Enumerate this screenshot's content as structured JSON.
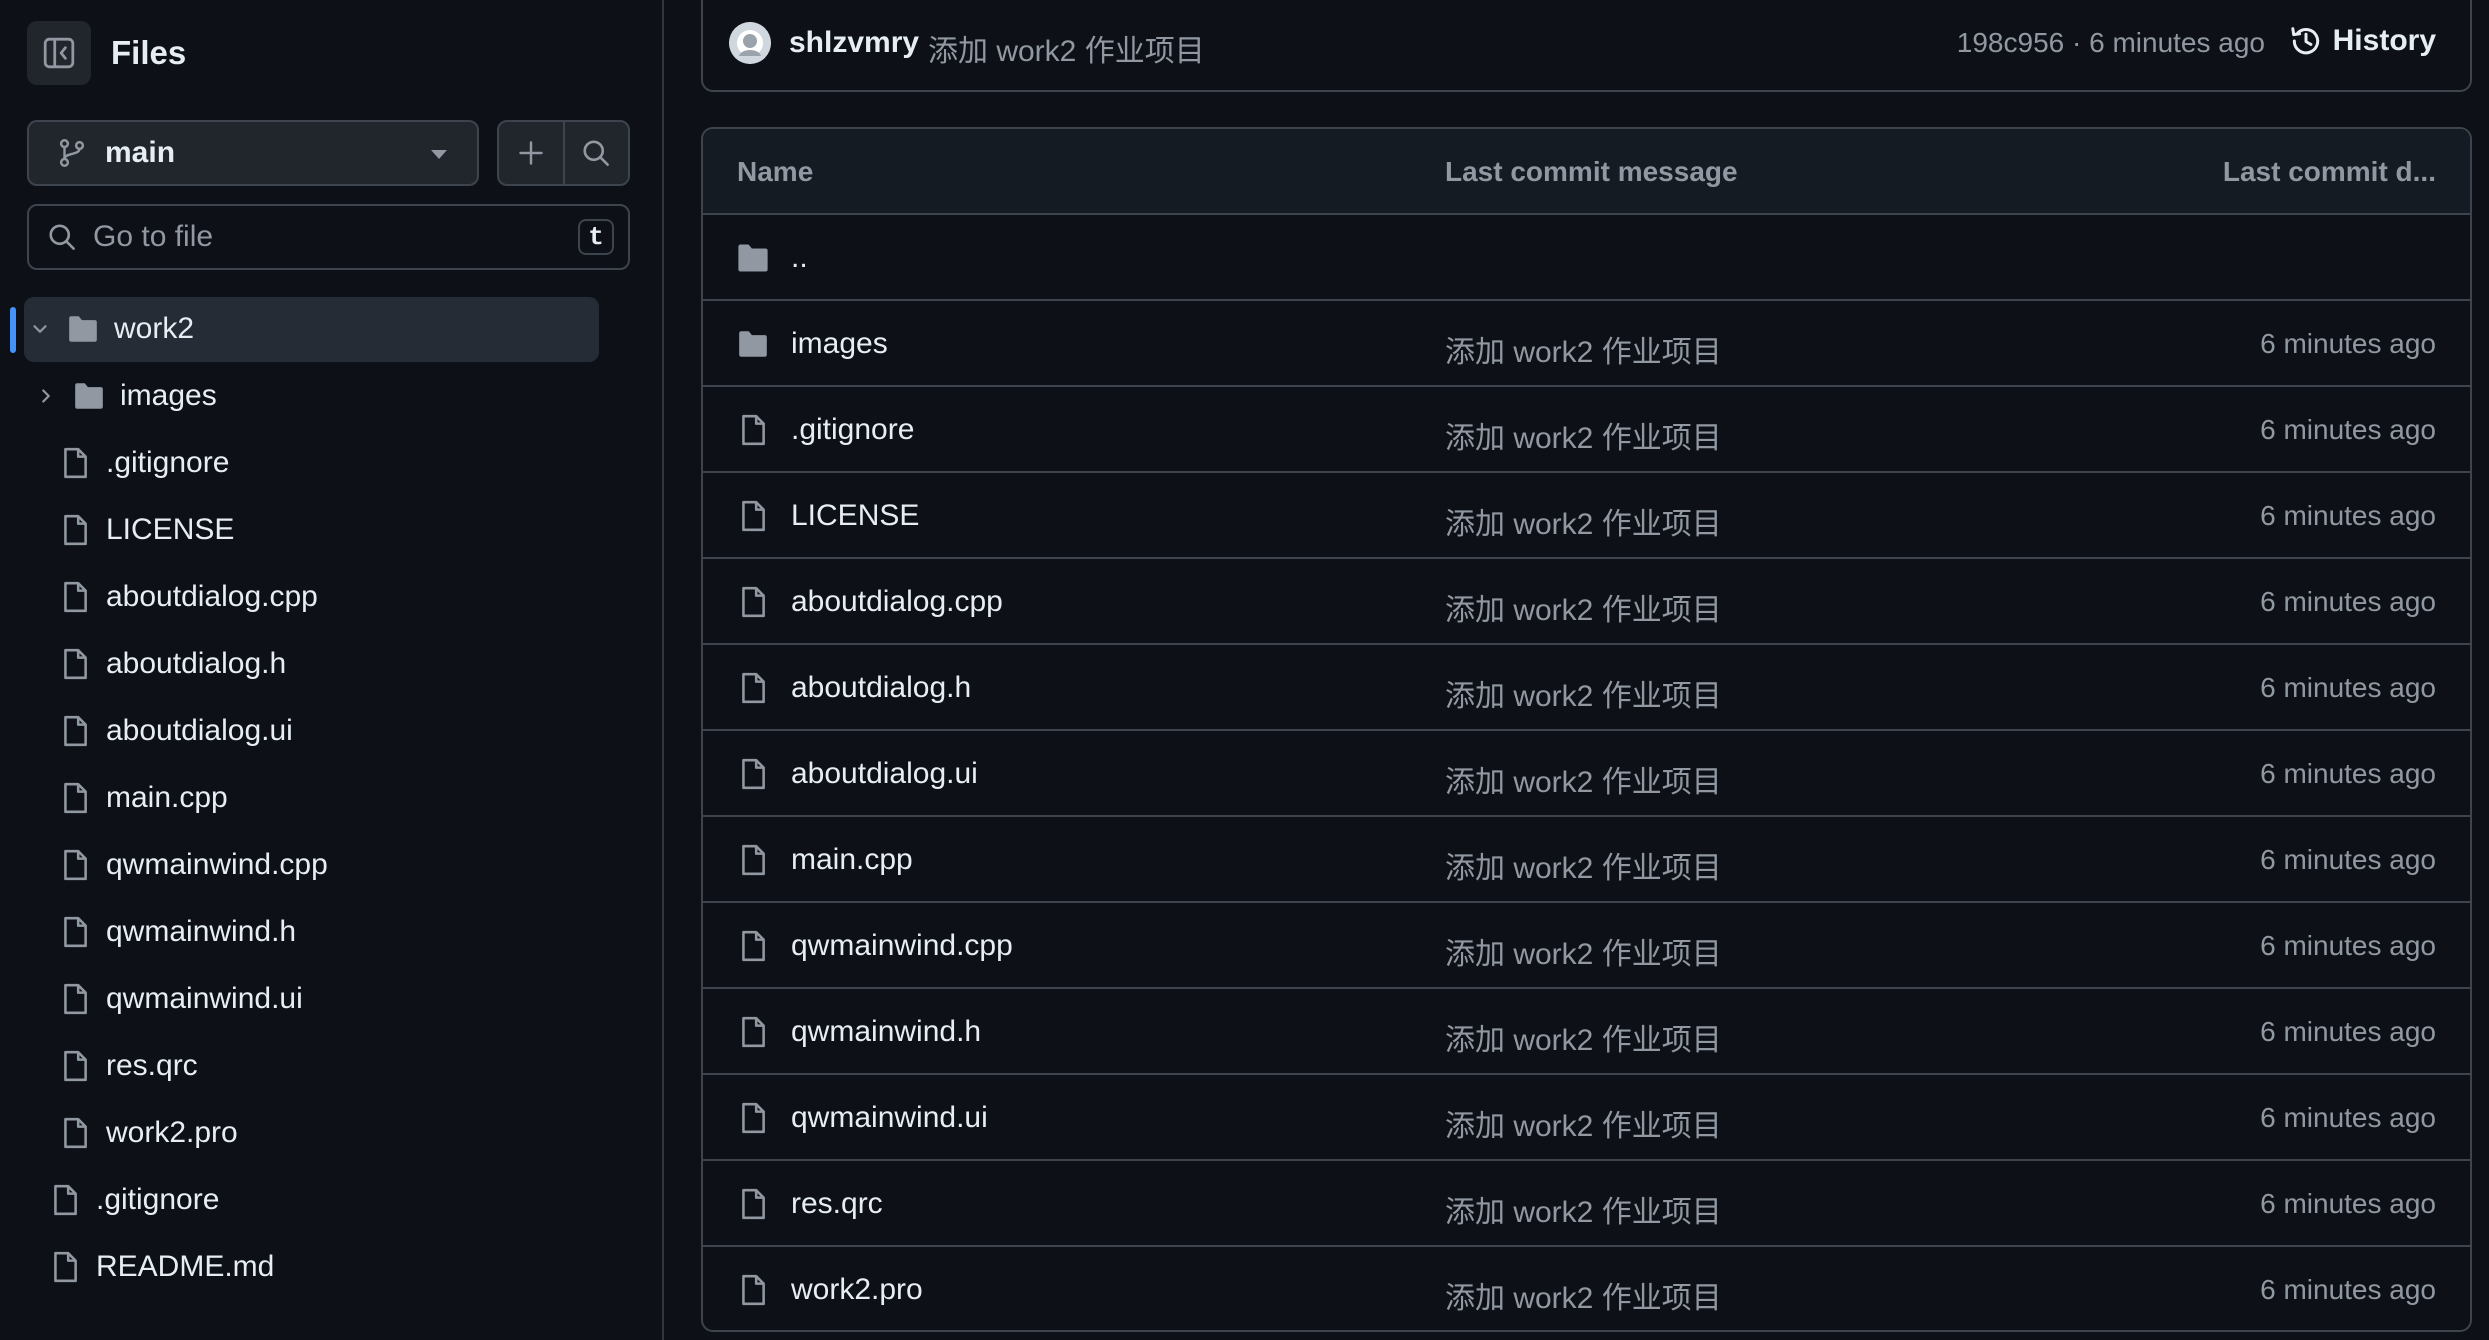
{
  "sidebar": {
    "title": "Files",
    "branch": "main",
    "goto_placeholder": "Go to file",
    "goto_shortcut": "t",
    "tree": [
      {
        "label": "work2",
        "type": "folder",
        "expanded": true,
        "selected": true,
        "depth": 0
      },
      {
        "label": "images",
        "type": "folder",
        "expanded": false,
        "depth": 1
      },
      {
        "label": ".gitignore",
        "type": "file",
        "depth": 1
      },
      {
        "label": "LICENSE",
        "type": "file",
        "depth": 1
      },
      {
        "label": "aboutdialog.cpp",
        "type": "file",
        "depth": 1
      },
      {
        "label": "aboutdialog.h",
        "type": "file",
        "depth": 1
      },
      {
        "label": "aboutdialog.ui",
        "type": "file",
        "depth": 1
      },
      {
        "label": "main.cpp",
        "type": "file",
        "depth": 1
      },
      {
        "label": "qwmainwind.cpp",
        "type": "file",
        "depth": 1
      },
      {
        "label": "qwmainwind.h",
        "type": "file",
        "depth": 1
      },
      {
        "label": "qwmainwind.ui",
        "type": "file",
        "depth": 1
      },
      {
        "label": "res.qrc",
        "type": "file",
        "depth": 1
      },
      {
        "label": "work2.pro",
        "type": "file",
        "depth": 1
      },
      {
        "label": ".gitignore",
        "type": "file",
        "depth": 0
      },
      {
        "label": "README.md",
        "type": "file",
        "depth": 0
      }
    ]
  },
  "commit": {
    "author": "shlzvmry",
    "message": "添加 work2 作业项目",
    "meta": "198c956 · 6 minutes ago",
    "history_label": "History"
  },
  "table": {
    "headers": {
      "name": "Name",
      "message": "Last commit message",
      "date": "Last commit d..."
    },
    "parent_row": "..",
    "rows": [
      {
        "name": "images",
        "type": "folder",
        "message": "添加 work2 作业项目",
        "date": "6 minutes ago"
      },
      {
        "name": ".gitignore",
        "type": "file",
        "message": "添加 work2 作业项目",
        "date": "6 minutes ago"
      },
      {
        "name": "LICENSE",
        "type": "file",
        "message": "添加 work2 作业项目",
        "date": "6 minutes ago"
      },
      {
        "name": "aboutdialog.cpp",
        "type": "file",
        "message": "添加 work2 作业项目",
        "date": "6 minutes ago"
      },
      {
        "name": "aboutdialog.h",
        "type": "file",
        "message": "添加 work2 作业项目",
        "date": "6 minutes ago"
      },
      {
        "name": "aboutdialog.ui",
        "type": "file",
        "message": "添加 work2 作业项目",
        "date": "6 minutes ago"
      },
      {
        "name": "main.cpp",
        "type": "file",
        "message": "添加 work2 作业项目",
        "date": "6 minutes ago"
      },
      {
        "name": "qwmainwind.cpp",
        "type": "file",
        "message": "添加 work2 作业项目",
        "date": "6 minutes ago"
      },
      {
        "name": "qwmainwind.h",
        "type": "file",
        "message": "添加 work2 作业项目",
        "date": "6 minutes ago"
      },
      {
        "name": "qwmainwind.ui",
        "type": "file",
        "message": "添加 work2 作业项目",
        "date": "6 minutes ago"
      },
      {
        "name": "res.qrc",
        "type": "file",
        "message": "添加 work2 作业项目",
        "date": "6 minutes ago"
      },
      {
        "name": "work2.pro",
        "type": "file",
        "message": "添加 work2 作业项目",
        "date": "6 minutes ago"
      }
    ]
  },
  "colors": {
    "background": "#0d1117",
    "border": "#3d444d",
    "muted_text": "#9198a1",
    "accent": "#4493f8",
    "folder_icon": "#9198a1"
  }
}
